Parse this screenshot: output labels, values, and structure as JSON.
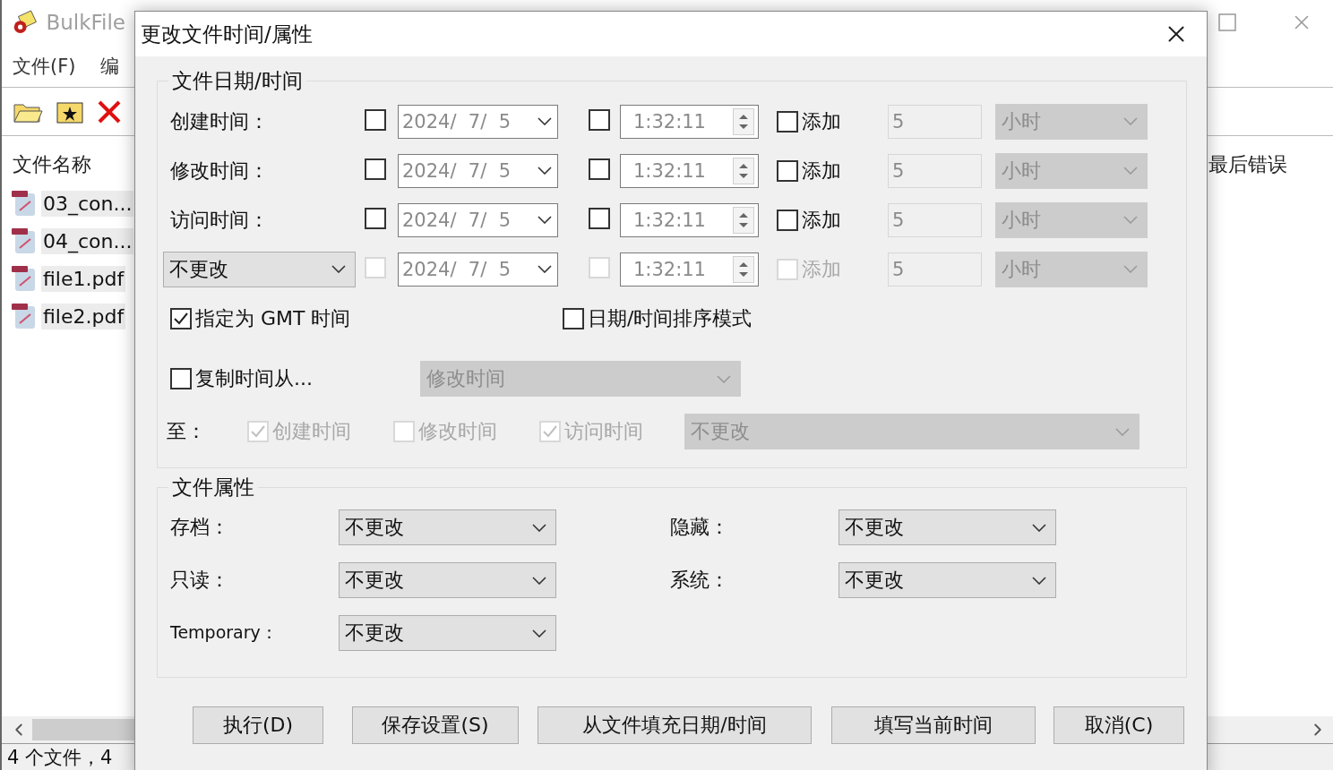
{
  "app": {
    "title": "BulkFile",
    "menu": [
      "文件(F)",
      "编"
    ],
    "list_header_left": "文件名称",
    "list_header_right": "最后错误",
    "files": [
      {
        "name": "03_con...",
        "selected": true
      },
      {
        "name": "04_con...",
        "selected": true
      },
      {
        "name": "file1.pdf",
        "selected": true
      },
      {
        "name": "file2.pdf",
        "selected": true
      }
    ],
    "status_bar": "4 个文件，4"
  },
  "dialog": {
    "title": "更改文件时间/属性",
    "date_group": {
      "title": "文件日期/时间",
      "rows": [
        {
          "kind": "label",
          "label": "创建时间：",
          "disabled": false,
          "date_checked": false,
          "date": "2024/  7/  5",
          "time_checked": false,
          "time": "1:32:11",
          "add_checked": false,
          "add_label": "添加",
          "amount": "5",
          "unit": "小时"
        },
        {
          "kind": "label",
          "label": "修改时间：",
          "disabled": false,
          "date_checked": false,
          "date": "2024/  7/  5",
          "time_checked": false,
          "time": "1:32:11",
          "add_checked": false,
          "add_label": "添加",
          "amount": "5",
          "unit": "小时"
        },
        {
          "kind": "label",
          "label": "访问时间：",
          "disabled": false,
          "date_checked": false,
          "date": "2024/  7/  5",
          "time_checked": false,
          "time": "1:32:11",
          "add_checked": false,
          "add_label": "添加",
          "amount": "5",
          "unit": "小时"
        },
        {
          "kind": "dropdown",
          "label": "不更改",
          "disabled": true,
          "date_checked": false,
          "date": "2024/  7/  5",
          "time_checked": false,
          "time": "1:32:11",
          "add_checked": false,
          "add_label": "添加",
          "amount": "5",
          "unit": "小时"
        }
      ],
      "gmt": {
        "label": "指定为 GMT 时间",
        "checked": true
      },
      "sort_mode": {
        "label": "日期/时间排序模式",
        "checked": false
      },
      "copy_from": {
        "label": "复制时间从...",
        "checked": false,
        "source": "修改时间",
        "disabled": true
      },
      "copy_to": {
        "label": "至：",
        "targets": [
          {
            "label": "创建时间",
            "checked": true
          },
          {
            "label": "修改时间",
            "checked": false
          },
          {
            "label": "访问时间",
            "checked": true
          }
        ],
        "mode": "不更改",
        "disabled": true
      }
    },
    "attr_group": {
      "title": "文件属性",
      "items": [
        {
          "label": "存档：",
          "value": "不更改"
        },
        {
          "label": "隐藏：",
          "value": "不更改"
        },
        {
          "label": "只读：",
          "value": "不更改"
        },
        {
          "label": "系统：",
          "value": "不更改"
        },
        {
          "label": "Temporary：",
          "value": "不更改"
        }
      ]
    },
    "buttons": [
      "执行(D)",
      "保存设置(S)",
      "从文件填充日期/时间",
      "填写当前时间",
      "取消(C)"
    ]
  }
}
